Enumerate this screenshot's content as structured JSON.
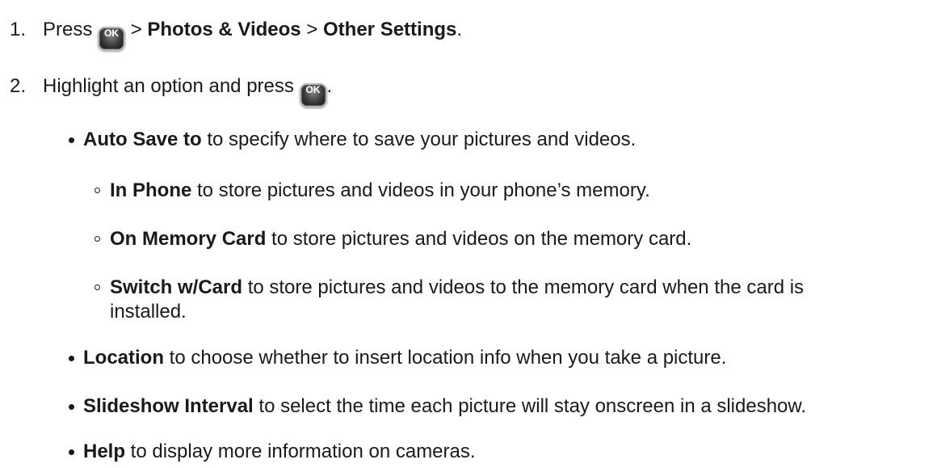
{
  "steps": [
    {
      "number": "1.",
      "prefix": "Press",
      "button_label": "OK",
      "sep1": " > ",
      "item1": "Photos & Videos",
      "sep2": " > ",
      "item2": "Other Settings",
      "end": "."
    },
    {
      "number": "2.",
      "text": "Highlight an option and press",
      "button_label": "OK",
      "end": "."
    }
  ],
  "options": [
    {
      "bold": "Auto Save to",
      "text": " to specify where to save your pictures and videos.",
      "suboptions": [
        {
          "bold": "In Phone",
          "text": " to store pictures and videos in your phone’s memory."
        },
        {
          "bold": "On Memory Card",
          "text": " to store pictures and videos on the memory card."
        },
        {
          "bold": "Switch w/Card",
          "text": " to store pictures and videos to the memory card when the card is",
          "text_cont": "installed."
        }
      ]
    },
    {
      "bold": "Location",
      "text": " to choose whether to insert location info when you take a picture."
    },
    {
      "bold": "Slideshow Interval",
      "text": " to select the time each picture will stay onscreen in a slideshow."
    },
    {
      "bold": "Help",
      "text": " to display more information on cameras."
    }
  ]
}
